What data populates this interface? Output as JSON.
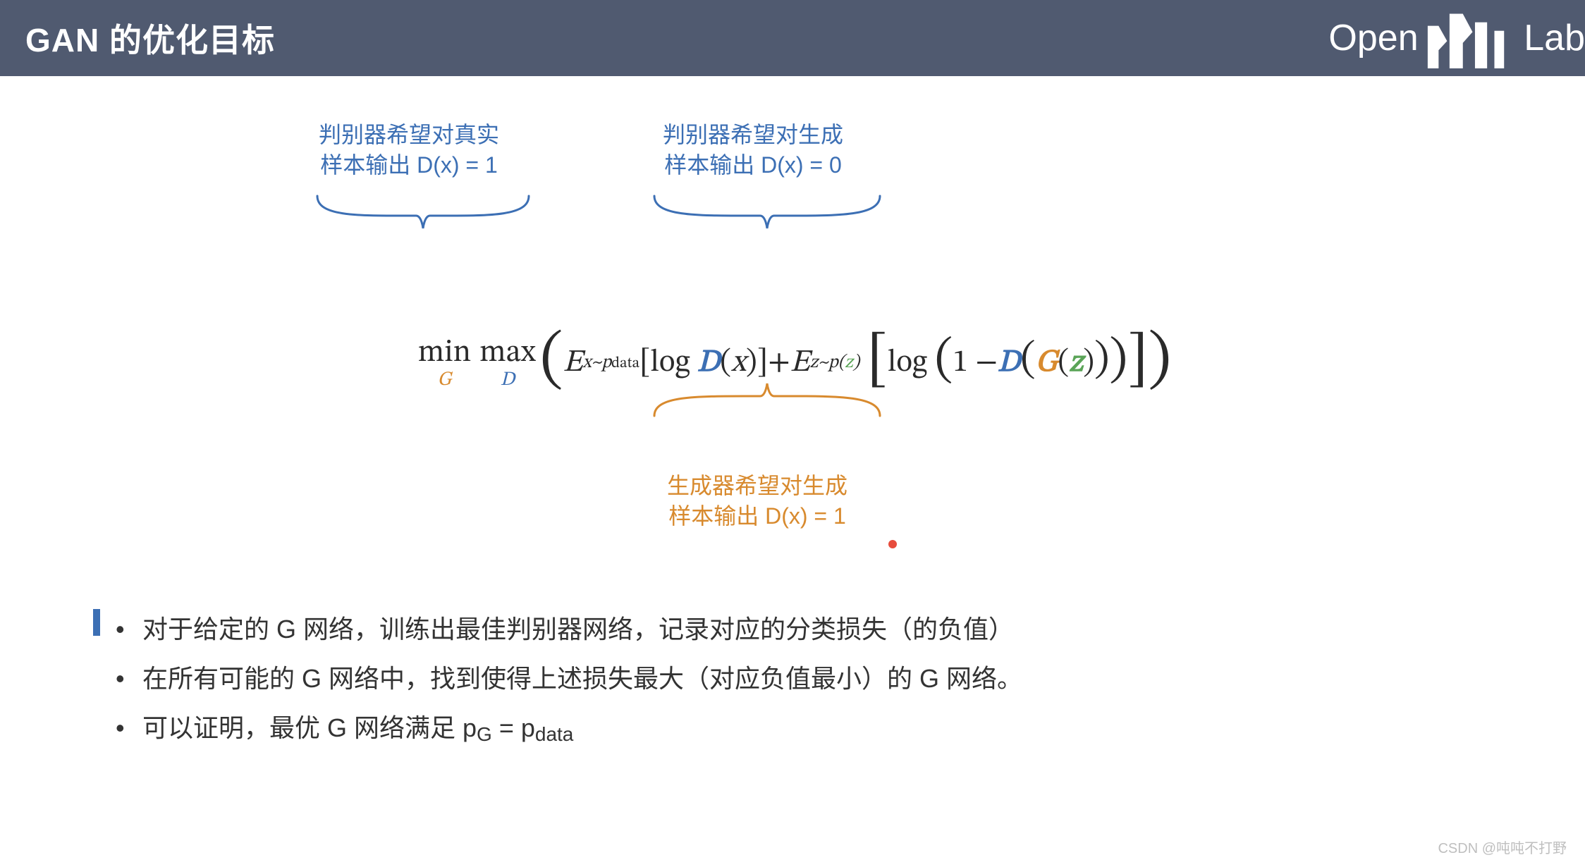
{
  "header": {
    "title": "GAN 的优化目标",
    "brand_left": "Open",
    "brand_right": "Lab"
  },
  "annotations": {
    "disc_real_l1": "判别器希望对真实",
    "disc_real_l2": "样本输出 D(x) = 1",
    "disc_fake_l1": "判别器希望对生成",
    "disc_fake_l2": "样本输出 D(x) = 0",
    "gen_l1": "生成器希望对生成",
    "gen_l2": "样本输出 D(x) = 1"
  },
  "formula": {
    "min": "min",
    "min_sub": "G",
    "max": "max",
    "max_sub": "D",
    "E1_pre": "E",
    "E1_sub_a": "x~p",
    "E1_sub_b": "data",
    "log1": "log",
    "D": "D",
    "x": "x",
    "plus": " + ",
    "E2_pre": "E",
    "E2_sub_a": "z~p(",
    "E2_sub_b": "z",
    "E2_sub_c": ")",
    "log2": "log",
    "one_minus": "1 − ",
    "G": "G",
    "z": "z"
  },
  "bullets": {
    "b1": "对于给定的 G 网络，训练出最佳判别器网络，记录对应的分类损失（的负值）",
    "b2": "在所有可能的 G 网络中，找到使得上述损失最大（对应负值最小）的 G 网络。",
    "b3_a": "可以证明，最优 G 网络满足 p",
    "b3_b": "G",
    "b3_c": " = p",
    "b3_d": "data"
  },
  "watermark": "CSDN @吨吨不打野"
}
